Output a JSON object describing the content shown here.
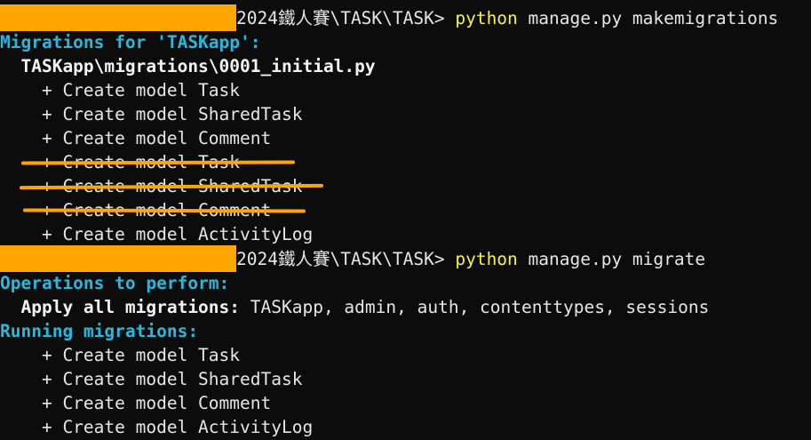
{
  "colors": {
    "background": "#0c0c0c",
    "cyan": "#29b8db",
    "yellow": "#f5f543",
    "redaction": "#ffa500",
    "strike": "#ffa500",
    "text": "#e6e6e6"
  },
  "prompt1": {
    "path": "2024鐵人賽\\TASK\\TASK> ",
    "command_name": "python",
    "command_args": " manage.py makemigrations"
  },
  "makemigrations": {
    "header": "Migrations for 'TASKapp':",
    "file": "  TASKapp\\migrations\\0001_initial.py",
    "ops": [
      "    + Create model Task",
      "    + Create model SharedTask",
      "    + Create model Comment",
      "    + Create model Task",
      "    + Create model SharedTask",
      "    + Create model Comment",
      "    + Create model ActivityLog"
    ]
  },
  "prompt2": {
    "path": "2024鐵人賽\\TASK\\TASK> ",
    "command_name": "python",
    "command_args": " manage.py migrate"
  },
  "migrate": {
    "ops_header": "Operations to perform:",
    "apply_label": "  Apply all migrations:",
    "apply_apps": " TASKapp, admin, auth, contenttypes, sessions",
    "running_header": "Running migrations:",
    "ops": [
      "    + Create model Task",
      "    + Create model SharedTask",
      "    + Create model Comment",
      "    + Create model ActivityLog"
    ]
  }
}
